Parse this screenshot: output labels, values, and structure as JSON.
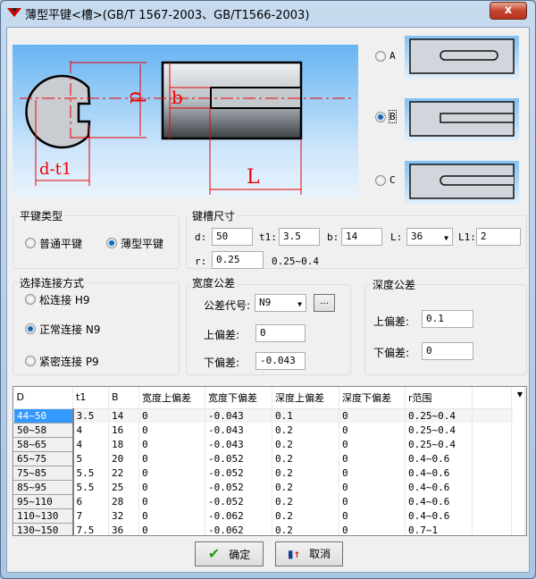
{
  "window": {
    "title": "薄型平键<槽>(GB/T 1567-2003、GB/T1566-2003)",
    "close": "x"
  },
  "picture": {
    "labels": {
      "d": "d",
      "b": "b",
      "dt1": "d-t1",
      "L": "L"
    }
  },
  "shape_options": [
    {
      "label": "A",
      "selected": false
    },
    {
      "label": "B",
      "selected": true
    },
    {
      "label": "C",
      "selected": false
    }
  ],
  "key_type": {
    "title": "平键类型",
    "options": [
      {
        "label": "普通平键",
        "selected": false
      },
      {
        "label": "薄型平键",
        "selected": true
      }
    ]
  },
  "slot": {
    "title": "键槽尺寸",
    "d_label": "d:",
    "d": "50",
    "t1_label": "t1:",
    "t1": "3.5",
    "b_label": "b:",
    "b": "14",
    "L_label": "L:",
    "L": "36",
    "L1_label": "L1:",
    "L1": "2",
    "r_label": "r:",
    "r": "0.25",
    "r_range": "0.25~0.4"
  },
  "connection": {
    "title": "选择连接方式",
    "options": [
      {
        "label": "松连接 H9",
        "selected": false
      },
      {
        "label": "正常连接 N9",
        "selected": true
      },
      {
        "label": "紧密连接 P9",
        "selected": false
      }
    ]
  },
  "width_tol": {
    "title": "宽度公差",
    "code_label": "公差代号:",
    "code": "N9",
    "browse": "...",
    "upper_label": "上偏差:",
    "upper": "0",
    "lower_label": "下偏差:",
    "lower": "-0.043"
  },
  "depth_tol": {
    "title": "深度公差",
    "upper_label": "上偏差:",
    "upper": "0.1",
    "lower_label": "下偏差:",
    "lower": "0"
  },
  "table": {
    "headers": [
      "D",
      "t1",
      "B",
      "宽度上偏差",
      "宽度下偏差",
      "深度上偏差",
      "深度下偏差",
      "r范围"
    ],
    "rows": [
      [
        "44~50",
        "3.5",
        "14",
        "0",
        "-0.043",
        "0.1",
        "0",
        "0.25~0.4"
      ],
      [
        "50~58",
        "4",
        "16",
        "0",
        "-0.043",
        "0.2",
        "0",
        "0.25~0.4"
      ],
      [
        "58~65",
        "4",
        "18",
        "0",
        "-0.043",
        "0.2",
        "0",
        "0.25~0.4"
      ],
      [
        "65~75",
        "5",
        "20",
        "0",
        "-0.052",
        "0.2",
        "0",
        "0.4~0.6"
      ],
      [
        "75~85",
        "5.5",
        "22",
        "0",
        "-0.052",
        "0.2",
        "0",
        "0.4~0.6"
      ],
      [
        "85~95",
        "5.5",
        "25",
        "0",
        "-0.052",
        "0.2",
        "0",
        "0.4~0.6"
      ],
      [
        "95~110",
        "6",
        "28",
        "0",
        "-0.052",
        "0.2",
        "0",
        "0.4~0.6"
      ],
      [
        "110~130",
        "7",
        "32",
        "0",
        "-0.062",
        "0.2",
        "0",
        "0.4~0.6"
      ],
      [
        "130~150",
        "7.5",
        "36",
        "0",
        "-0.062",
        "0.2",
        "0",
        "0.7~1"
      ]
    ],
    "selected_row": 0
  },
  "buttons": {
    "ok": "确定",
    "cancel": "取消"
  }
}
